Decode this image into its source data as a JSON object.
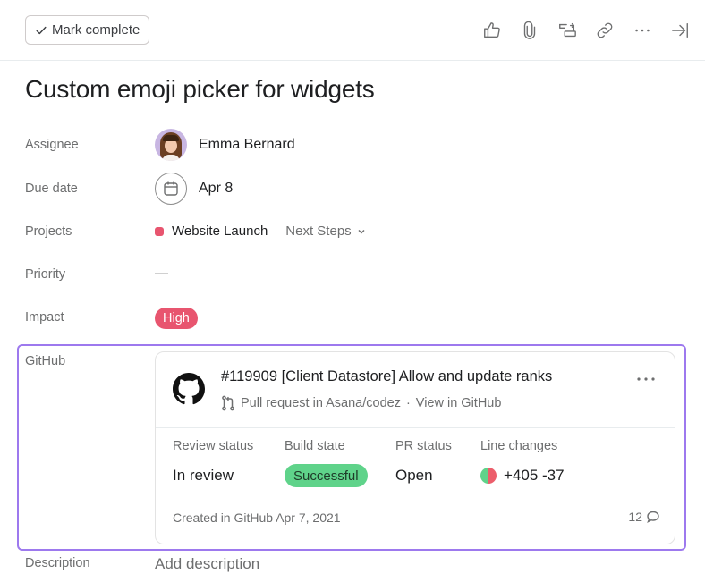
{
  "toolbar": {
    "mark_complete_label": "Mark complete",
    "icons": [
      "thumbs-up-icon",
      "paperclip-icon",
      "subtask-icon",
      "link-icon",
      "more-icon",
      "close-pane-icon"
    ]
  },
  "task": {
    "title": "Custom emoji picker for widgets"
  },
  "fields": {
    "assignee": {
      "label": "Assignee",
      "value": "Emma Bernard"
    },
    "due_date": {
      "label": "Due date",
      "value": "Apr 8"
    },
    "projects": {
      "label": "Projects",
      "project_name": "Website Launch",
      "project_color": "#e8556f",
      "section": "Next Steps"
    },
    "priority": {
      "label": "Priority",
      "value": "—"
    },
    "impact": {
      "label": "Impact",
      "value": "High",
      "color": "#e8556f"
    },
    "github": {
      "label": "GitHub"
    },
    "description": {
      "label": "Description",
      "placeholder": "Add description"
    }
  },
  "github_card": {
    "title": "#119909 [Client Datastore] Allow and update ranks",
    "subtitle": "Pull request in Asana/codez",
    "separator": "·",
    "view_link": "View in GitHub",
    "columns": [
      {
        "label": "Review status",
        "value": "In review"
      },
      {
        "label": "Build state",
        "value": "Successful",
        "color": "#5fd38a"
      },
      {
        "label": "PR status",
        "value": "Open"
      },
      {
        "label": "Line changes",
        "value": "+405 -37",
        "added_color": "#5fd38a",
        "removed_color": "#ec5e6b"
      }
    ],
    "created": "Created in GitHub Apr 7, 2021",
    "comment_count": "12"
  },
  "colors": {
    "focus_border": "#9d79ee"
  }
}
